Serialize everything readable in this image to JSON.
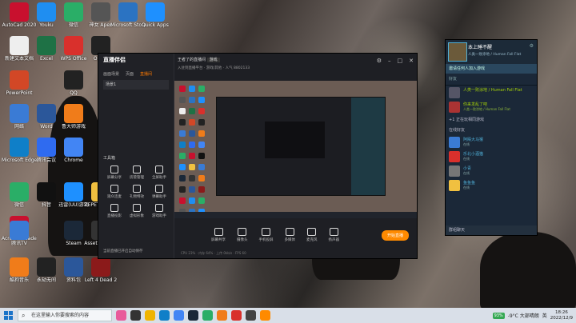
{
  "desktop_icons": [
    {
      "label": "AutoCad 2020",
      "color": "#c8102e"
    },
    {
      "label": "Youku",
      "color": "#1f8ef1"
    },
    {
      "label": "微信",
      "color": "#2aae67"
    },
    {
      "label": "神女 Apex",
      "color": "#555555"
    },
    {
      "label": "Microsoft Store",
      "color": "#2b73c2"
    },
    {
      "label": "Quick Apps",
      "color": "#1e90ff"
    },
    {
      "label": "新建文本文档",
      "color": "#eeeeee"
    },
    {
      "label": "Excel",
      "color": "#1e7145"
    },
    {
      "label": "WPS Office",
      "color": "#d9302c"
    },
    {
      "label": "Origin",
      "color": "#222222"
    },
    {
      "label": "PowerPoint",
      "color": "#d24726"
    },
    {
      "label": "QQ",
      "color": "#222222"
    },
    {
      "label": "网络",
      "color": "#3a7bd5"
    },
    {
      "label": "Word",
      "color": "#2b579a"
    },
    {
      "label": "鲁大师游戏",
      "color": "#f07c1a"
    },
    {
      "label": "Microsoft Edge",
      "color": "#0f7fc8"
    },
    {
      "label": "腾讯会议",
      "color": "#2f6bf0"
    },
    {
      "label": "Chrome",
      "color": "#4285f4"
    },
    {
      "label": "微信",
      "color": "#2aae67"
    },
    {
      "label": "Acrobat Reader",
      "color": "#c8102e"
    },
    {
      "label": "抖音",
      "color": "#111111"
    },
    {
      "label": "迅雷(UU)游戏",
      "color": "#1e90ff"
    },
    {
      "label": "ZEPETO PARK",
      "color": "#f0c040"
    },
    {
      "label": "腾讯TV",
      "color": "#3a7bd5"
    },
    {
      "label": "Steam",
      "color": "#1b2838"
    },
    {
      "label": "Assetto Corsa",
      "color": "#333333"
    },
    {
      "label": "酷狗音乐",
      "color": "#f07c1a"
    },
    {
      "label": "永劫无间",
      "color": "#222222"
    },
    {
      "label": "资料包",
      "color": "#2b579a"
    },
    {
      "label": "Left 4 Dead 2",
      "color": "#8b1a1a"
    }
  ],
  "app": {
    "logo": "直播伴侣",
    "tabs": [
      "画面场景",
      "页面",
      "直播间"
    ],
    "active_tab": 2,
    "scene_label": "场景1",
    "tools_title": "工具箱",
    "tools": [
      "屏幕分享",
      "房管管理",
      "全屏助手",
      "观众连麦",
      "礼物特效",
      "弹幕助手",
      "直播投影",
      "虚拟形象",
      "游戏助手"
    ],
    "note": "当前直播已开启自动保存",
    "title": "王者了的直播间",
    "title_tag": "游戏",
    "sub": "入驻到直播平台 · 游戏/其他 · 人气 8802133",
    "bottom_items": [
      "屏幕共享",
      "摄像头",
      "手机投屏",
      "多媒体",
      "麦克风",
      "扬声器"
    ],
    "start_label": "开始直播",
    "status": "CPU 23% · 内存 64% · 上传 0kb/s · FPS 60"
  },
  "steam": {
    "name": "本上睡不醒",
    "status": "人类一败涂地 / Human Fall Flat",
    "invite": "邀请任何人加入游戏",
    "search": "好友",
    "self_game": "人类一败涂地 / Human Fall Flat",
    "friends_game": [
      {
        "name": "你来发乱了吧",
        "status": "人类一败涂地 / Human Fall Flat"
      }
    ],
    "extra": "+1  正在玩相同游戏",
    "online_section": "在线好友",
    "online": [
      {
        "name": "阿殿大马猴",
        "status": "在线"
      },
      {
        "name": "乐北小酒猫",
        "status": "在线"
      },
      {
        "name": "小青",
        "status": "在线"
      },
      {
        "name": "鱼鱼鱼",
        "status": "在线"
      }
    ],
    "footer": "群组聊天"
  },
  "taskbar": {
    "search_placeholder": "在这里输入你要搜索的内容",
    "battery": "93%",
    "weather": "-9°C 大部晴朗",
    "ime": "英",
    "time": "18:26",
    "date": "2022/12/9"
  }
}
